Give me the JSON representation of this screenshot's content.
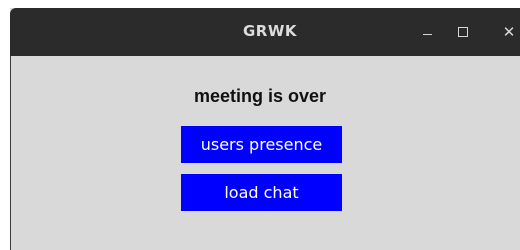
{
  "window": {
    "title": "GRWK",
    "controls": {
      "minimize_icon": "minimize-icon",
      "maximize_icon": "maximize-icon",
      "close_icon": "close-icon",
      "close_glyph": "✕"
    }
  },
  "main": {
    "heading": "meeting is over",
    "buttons": [
      {
        "label": "users presence"
      },
      {
        "label": "load chat"
      }
    ]
  },
  "colors": {
    "titlebar": "#2b2b2b",
    "background": "#d9d9d9",
    "button": "#0000ff",
    "button_text": "#ffffff"
  }
}
